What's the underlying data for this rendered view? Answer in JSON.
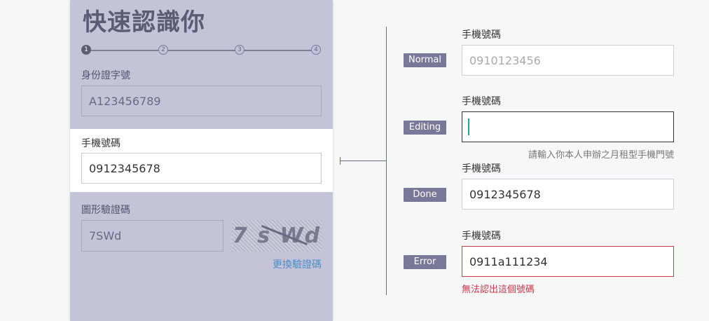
{
  "form": {
    "title": "快速認識你",
    "steps": [
      "1",
      "2",
      "3",
      "4"
    ],
    "id_label": "身份證字號",
    "id_value": "A123456789",
    "phone_label": "手機號碼",
    "phone_value": "0912345678",
    "captcha_label": "圖形驗證碼",
    "captcha_value": "7SWd",
    "captcha_image_text": "7 s Wd",
    "refresh_label": "更換驗證碼"
  },
  "states": {
    "normal": {
      "badge": "Normal",
      "label": "手機號碼",
      "placeholder": "0910123456"
    },
    "editing": {
      "badge": "Editing",
      "label": "手機號碼",
      "hint": "請輸入你本人申辦之月租型手機門號"
    },
    "done": {
      "badge": "Done",
      "label": "手機號碼",
      "value": "0912345678"
    },
    "error": {
      "badge": "Error",
      "label": "手機號碼",
      "value": "0911a111234",
      "message": "無法認出這個號碼"
    }
  },
  "colors": {
    "panel_bg": "#c4c3d8",
    "badge_bg": "#7a7899",
    "caret": "#1aa79a",
    "error": "#c8394d",
    "link": "#4b8fc4"
  }
}
